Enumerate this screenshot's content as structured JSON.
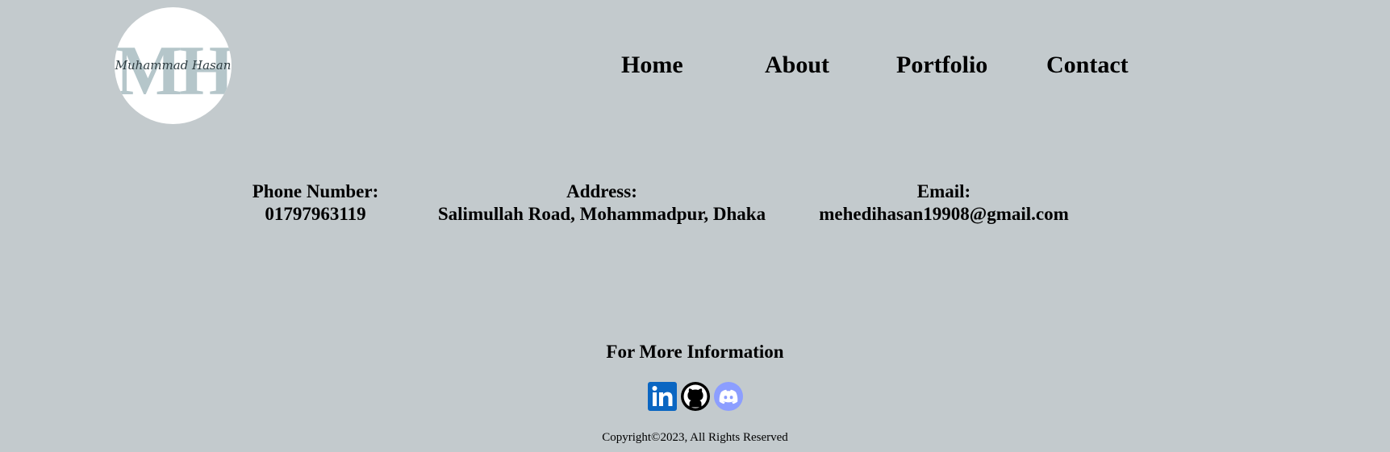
{
  "logo": {
    "monogram": "MH",
    "signature": "Muhammad Hasan"
  },
  "nav": {
    "items": [
      {
        "label": "Home"
      },
      {
        "label": "About"
      },
      {
        "label": "Portfolio"
      },
      {
        "label": "Contact"
      }
    ]
  },
  "contact": {
    "phone": {
      "label": "Phone Number:",
      "value": "01797963119"
    },
    "address": {
      "label": "Address:",
      "value": "Salimullah Road, Mohammadpur, Dhaka"
    },
    "email": {
      "label": "Email:",
      "value": "mehedihasan19908@gmail.com"
    }
  },
  "footer": {
    "heading": "For More Information",
    "social": [
      {
        "icon": "linkedin-icon"
      },
      {
        "icon": "github-icon"
      },
      {
        "icon": "discord-icon"
      }
    ],
    "copyright": "Copyright©2023, All Rights Reserved"
  },
  "colors": {
    "background": "#c3cacd",
    "monogram": "#b5c6ca",
    "linkedin": "#0a66c2",
    "discord": "#8c9eff"
  }
}
